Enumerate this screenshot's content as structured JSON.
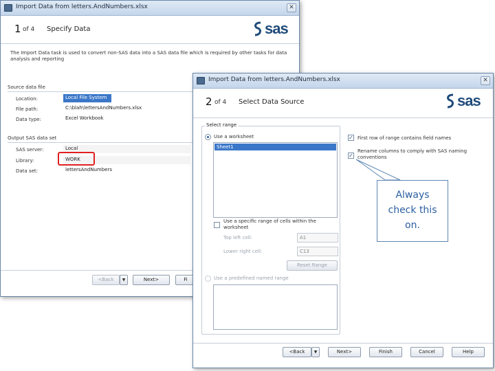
{
  "back_window": {
    "title": "Import Data from letters.AndNumbers.xlsx",
    "step_number": "1",
    "step_of": "of 4",
    "step_title": "Specify Data",
    "logo": "sas",
    "description": "The Import Data task is used to convert non-SAS data into a SAS data file which is required by other tasks for data analysis and reporting",
    "source_group_label": "Source data file",
    "location_label": "Location:",
    "location_value": "Local File System",
    "file_path_label": "File path:",
    "file_path_value": "C:\\blah\\lettersAndNumbers.xlsx",
    "data_type_label": "Data type:",
    "data_type_value": "Excel Workbook",
    "output_group_label": "Output SAS data set",
    "sas_server_label": "SAS server:",
    "sas_server_value": "Local",
    "library_label": "Library:",
    "library_value": "WORK",
    "data_set_label": "Data set:",
    "data_set_value": "lettersAndNumbers",
    "back_button": "<Back",
    "next_button": "Next>",
    "finish_button": "Fi"
  },
  "front_window": {
    "title": "Import Data from letters.AndNumbers.xlsx",
    "step_number": "2",
    "step_of": "of 4",
    "step_title": "Select Data Source",
    "logo": "sas",
    "select_range_label": "Select range",
    "use_worksheet_label": "Use a worksheet",
    "worksheet_items": [
      "Sheet1"
    ],
    "specific_range_label": "Use a specific range of cells within the worksheet",
    "top_left_label": "Top left cell:",
    "top_left_value": "A1",
    "lower_right_label": "Lower right cell:",
    "lower_right_value": "C13",
    "reset_range_button": "Reset Range",
    "named_range_label": "Use a predefined named range",
    "first_row_label": "First row of range contains field names",
    "first_row_checked": true,
    "rename_columns_label": "Rename columns to comply with SAS naming conventions",
    "rename_columns_checked": true,
    "back_button": "<Back",
    "next_button": "Next>",
    "finish_button": "Finish",
    "cancel_button": "Cancel",
    "help_button": "Help"
  },
  "callout": {
    "line1": "Always",
    "line2": "check this",
    "line3": "on."
  },
  "colors": {
    "selection": "#3b77c9",
    "highlight": "#e02020",
    "callout_text": "#2b5fa0",
    "sas_blue": "#1f4b7a"
  }
}
